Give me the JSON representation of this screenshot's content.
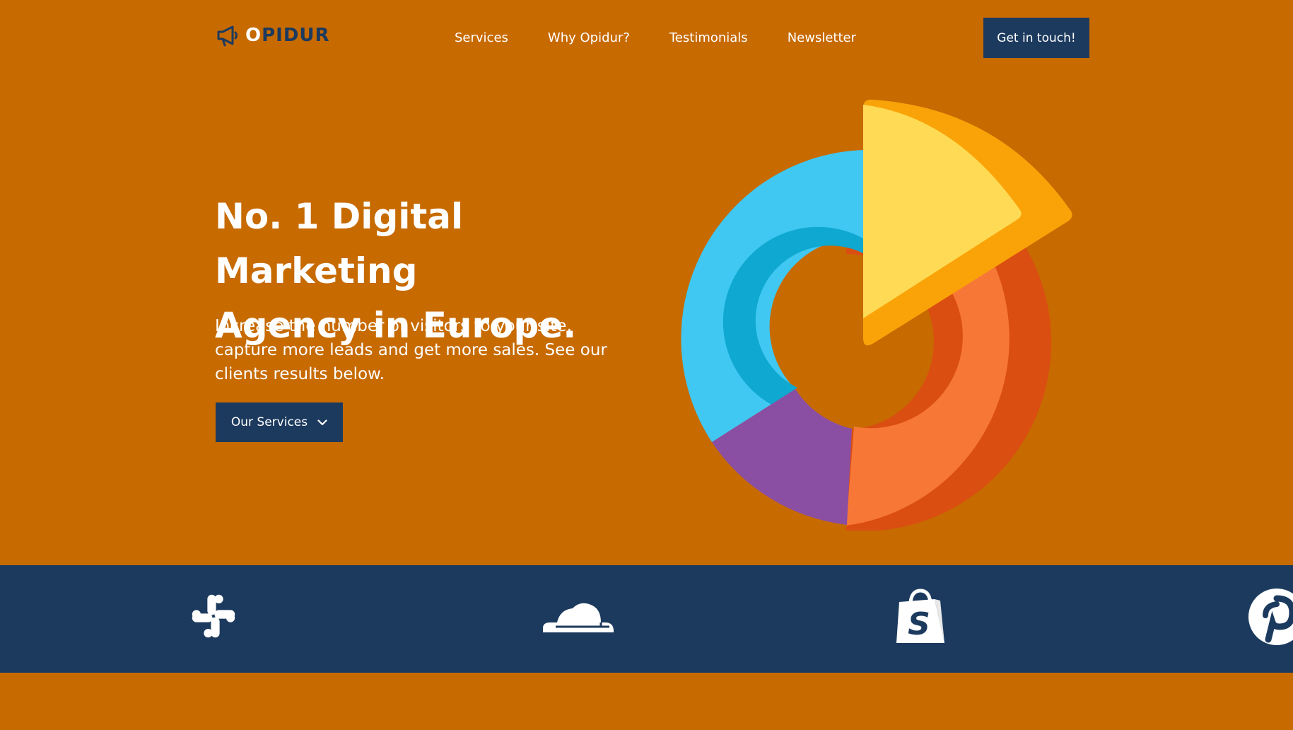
{
  "header": {
    "logo": {
      "first_letter": "O",
      "rest": "PIDUR",
      "icon": "megaphone-icon"
    },
    "nav": [
      "Services",
      "Why Opidur?",
      "Testimonials",
      "Newsletter"
    ],
    "cta_label": "Get in touch!"
  },
  "hero": {
    "title_line1": "No. 1 Digital Marketing",
    "title_line2": "Agency in Europe.",
    "subtitle": "Increase the number of visitors to your site, capture more leads and get more sales. See our clients results below.",
    "button_label": "Our Services",
    "button_icon": "chevron-down-icon",
    "illustration": "donut-chart-illustration"
  },
  "brands": {
    "logos": [
      "slack-logo",
      "cloudflare-logo",
      "shopify-logo",
      "pinterest-logo"
    ]
  },
  "colors": {
    "background": "#C76A00",
    "navy": "#1C3A5E",
    "white": "#FFFFFF",
    "cyan": "#40C8F2",
    "cyan_dark": "#0FA8D0",
    "purple": "#8A4FA3",
    "orange": "#F77736",
    "orange_dark": "#DA4E11",
    "yellow": "#FFDB55",
    "amber": "#FAA309"
  }
}
